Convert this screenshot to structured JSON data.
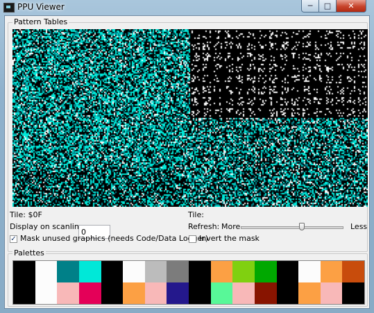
{
  "window": {
    "title": "PPU Viewer",
    "minimize_glyph": "─",
    "maximize_glyph": "□",
    "close_glyph": "✕",
    "icon": "app-icon"
  },
  "pattern_tables": {
    "group_label": "Pattern Tables",
    "left": {
      "tile_label": "Tile: $0F",
      "scanline_label": "Display on scanline:",
      "scanline_value": "0"
    },
    "right": {
      "tile_label": "Tile:",
      "refresh_label": "Refresh:",
      "refresh_more": "More",
      "refresh_less": "Less",
      "refresh_level": 0.6
    },
    "mask_unused_label": "Mask unused graphics (needs Code/Data Logger)",
    "mask_unused_checked": true,
    "invert_mask_label": "Invert the mask",
    "invert_mask_checked": false,
    "check_glyph": "✓"
  },
  "palettes": {
    "group_label": "Palettes",
    "row1": [
      "#000000",
      "#FCFCFC",
      "#008088",
      "#00E8D8",
      "#000000",
      "#FCFCFC",
      "#BCBCBC",
      "#7C7C7C",
      "#000000",
      "#FCA044",
      "#80D010",
      "#00A800",
      "#000000",
      "#FCFCFC",
      "#FCA044",
      "#C84C0C"
    ],
    "row2": [
      "#000000",
      "#FCFCFC",
      "#F8B8B8",
      "#E40058",
      "#000000",
      "#FCA044",
      "#F8B8B8",
      "#24188C",
      "#000000",
      "#58F898",
      "#F8B8B8",
      "#881400",
      "#000000",
      "#FCA044",
      "#F8B8B8",
      "#000000"
    ]
  }
}
